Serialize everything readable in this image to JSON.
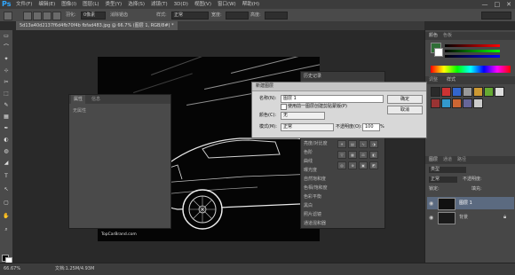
{
  "app": {
    "logo": "Ps",
    "menus": [
      "文件(F)",
      "编辑(E)",
      "图像(I)",
      "图层(L)",
      "类型(Y)",
      "选择(S)",
      "滤镜(T)",
      "3D(D)",
      "视图(V)",
      "窗口(W)",
      "帮助(H)"
    ],
    "window_controls": [
      "—",
      "□",
      "✕"
    ]
  },
  "options": {
    "feather_label": "羽化:",
    "feather_value": "0像素",
    "antialias_label": "消除锯齿",
    "style_label": "样式:",
    "style_value": "正常",
    "width_label": "宽度:",
    "height_label": "高度:"
  },
  "document": {
    "tab_title": "5d13a40d2137f6d4fb70f4b fbfad483.jpg @ 66.7% (图层 1, RGB/8#) *",
    "watermark": "TopCarBrand.com"
  },
  "tools": [
    "▭",
    "⌒",
    "✦",
    "⊹",
    "✂",
    "⬚",
    "✎",
    "▦",
    "✒",
    "◐",
    "◍",
    "◢",
    "T",
    "↖",
    "▢",
    "✋",
    "⌕"
  ],
  "properties_panel": {
    "tabs": [
      "属性",
      "信息"
    ],
    "content": "无属性"
  },
  "history_panel": {
    "title": "历史记录"
  },
  "adjustments": {
    "items": [
      "亮度/对比度",
      "色阶",
      "曲线",
      "曝光度",
      "自然饱和度",
      "色相/饱和度",
      "色彩平衡",
      "黑白",
      "照片滤镜",
      "通道混和器",
      "颜色查找",
      "反相",
      "色调分离",
      "阈值",
      "渐变映射",
      "可选颜色"
    ]
  },
  "right_panels": {
    "color": {
      "tabs": [
        "颜色",
        "色板"
      ],
      "fg": "#2f6e36",
      "bg": "#ffffff"
    },
    "styles": {
      "tabs": [
        "调整",
        "样式"
      ]
    },
    "layers": {
      "tabs": [
        "图层",
        "通道",
        "路径"
      ],
      "kind_label": "类型",
      "blend_mode": "正常",
      "opacity_label": "不透明度:",
      "lock_label": "锁定:",
      "fill_label": "填充:",
      "rows": [
        {
          "name": "图层 1",
          "selected": true
        },
        {
          "name": "背景",
          "selected": false
        }
      ]
    }
  },
  "status": {
    "zoom": "66.67%",
    "doc_info": "文档:1.25M/4.93M"
  },
  "dialog": {
    "title": "新建图层",
    "name_label": "名称(N):",
    "name_value": "图层 1",
    "clip_label": "使用前一图层创建剪贴蒙版(P)",
    "color_label": "颜色(C):",
    "color_value": "无",
    "mode_label": "模式(M):",
    "mode_value": "正常",
    "opacity_label": "不透明度(O):",
    "opacity_value": "100",
    "opacity_unit": "%",
    "ok_label": "确定",
    "cancel_label": "取消"
  }
}
